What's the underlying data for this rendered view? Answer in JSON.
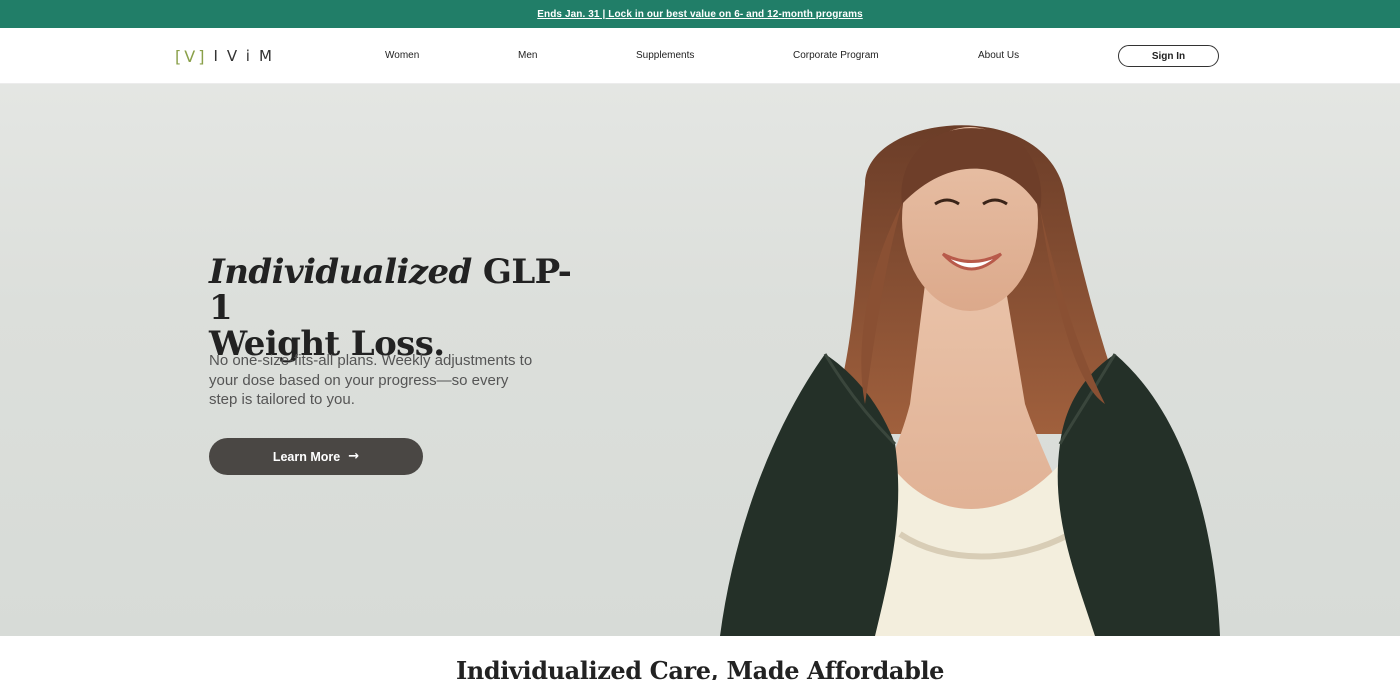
{
  "announcement": {
    "text": "Ends Jan. 31 | Lock in our best value on 6- and 12-month programs"
  },
  "header": {
    "logo": {
      "mark": "[V]",
      "word": "IViM"
    },
    "nav": [
      {
        "label": "Women"
      },
      {
        "label": "Men"
      },
      {
        "label": "Supplements"
      },
      {
        "label": "Corporate Program"
      },
      {
        "label": "About Us"
      }
    ],
    "signin_label": "Sign In"
  },
  "hero": {
    "title_italic": "Individualized",
    "title_rest": " GLP-1",
    "title_line2": "Weight Loss.",
    "subtitle": "No one-size-fits-all plans. Weekly adjustments to your dose based on your progress—so every step is tailored to you.",
    "cta_label": "Learn More",
    "cta_icon": "arrow-right-icon"
  },
  "section": {
    "title": "Individualized Care, Made Affordable"
  },
  "colors": {
    "announcement_bg": "#217e68",
    "logo_accent": "#8aa04a",
    "cta_bg": "#4a4744",
    "hero_bg": "#dfe2de"
  }
}
